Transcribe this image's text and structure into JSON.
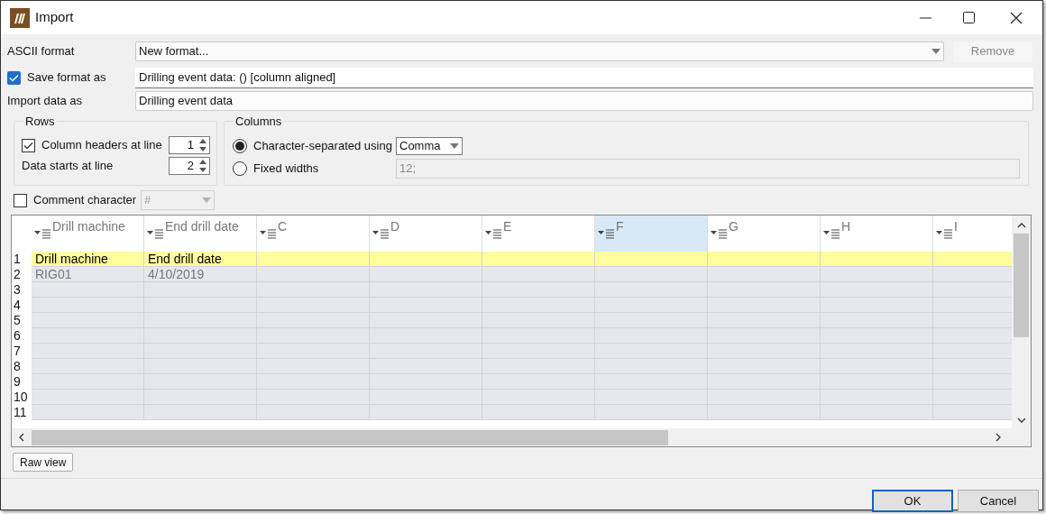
{
  "window": {
    "title": "Import"
  },
  "ascii_format": {
    "label": "ASCII format",
    "value": "New format...",
    "remove_button": {
      "label": "Remove",
      "disabled": true
    }
  },
  "save_format": {
    "label": "Save format as",
    "checked": true,
    "value": "Drilling event data: () [column aligned]"
  },
  "import_as": {
    "label": "Import data as",
    "value": "Drilling event data"
  },
  "rows_group": {
    "title": "Rows",
    "headers": {
      "label": "Column headers at line",
      "checked": true,
      "value": "1"
    },
    "data_start": {
      "label": "Data starts at line",
      "value": "2"
    }
  },
  "columns_group": {
    "title": "Columns",
    "options": [
      {
        "label": "Character-separated using",
        "selected": true,
        "kind": "select",
        "value": "Comma",
        "disabled": false
      },
      {
        "label": "Fixed widths",
        "selected": false,
        "kind": "text",
        "value": "12;",
        "disabled": true
      }
    ]
  },
  "comment": {
    "label": "Comment character",
    "checked": false,
    "value": "#",
    "disabled": true
  },
  "table": {
    "columns": [
      {
        "label": "Drill machine",
        "selected": false
      },
      {
        "label": "End drill date",
        "selected": false
      },
      {
        "label": "C",
        "selected": false
      },
      {
        "label": "D",
        "selected": false
      },
      {
        "label": "E",
        "selected": false
      },
      {
        "label": "F",
        "selected": true
      },
      {
        "label": "G",
        "selected": false
      },
      {
        "label": "H",
        "selected": false
      },
      {
        "label": "I",
        "selected": false
      }
    ],
    "rows": [
      {
        "number": "1",
        "kind": "header",
        "cells": [
          "Drill machine",
          "End drill date"
        ]
      },
      {
        "number": "2",
        "kind": "data",
        "cells": [
          "RIG01",
          "4/10/2019"
        ]
      },
      {
        "number": "3",
        "kind": "data",
        "cells": []
      },
      {
        "number": "4",
        "kind": "data",
        "cells": []
      },
      {
        "number": "5",
        "kind": "data",
        "cells": []
      },
      {
        "number": "6",
        "kind": "data",
        "cells": []
      },
      {
        "number": "7",
        "kind": "data",
        "cells": []
      },
      {
        "number": "8",
        "kind": "data",
        "cells": []
      },
      {
        "number": "9",
        "kind": "data",
        "cells": []
      },
      {
        "number": "10",
        "kind": "data",
        "cells": []
      },
      {
        "number": "11",
        "kind": "data",
        "cells": []
      }
    ]
  },
  "raw_view_button": "Raw view",
  "buttons": [
    {
      "label": "OK",
      "default": true
    },
    {
      "label": "Cancel",
      "default": false
    }
  ]
}
